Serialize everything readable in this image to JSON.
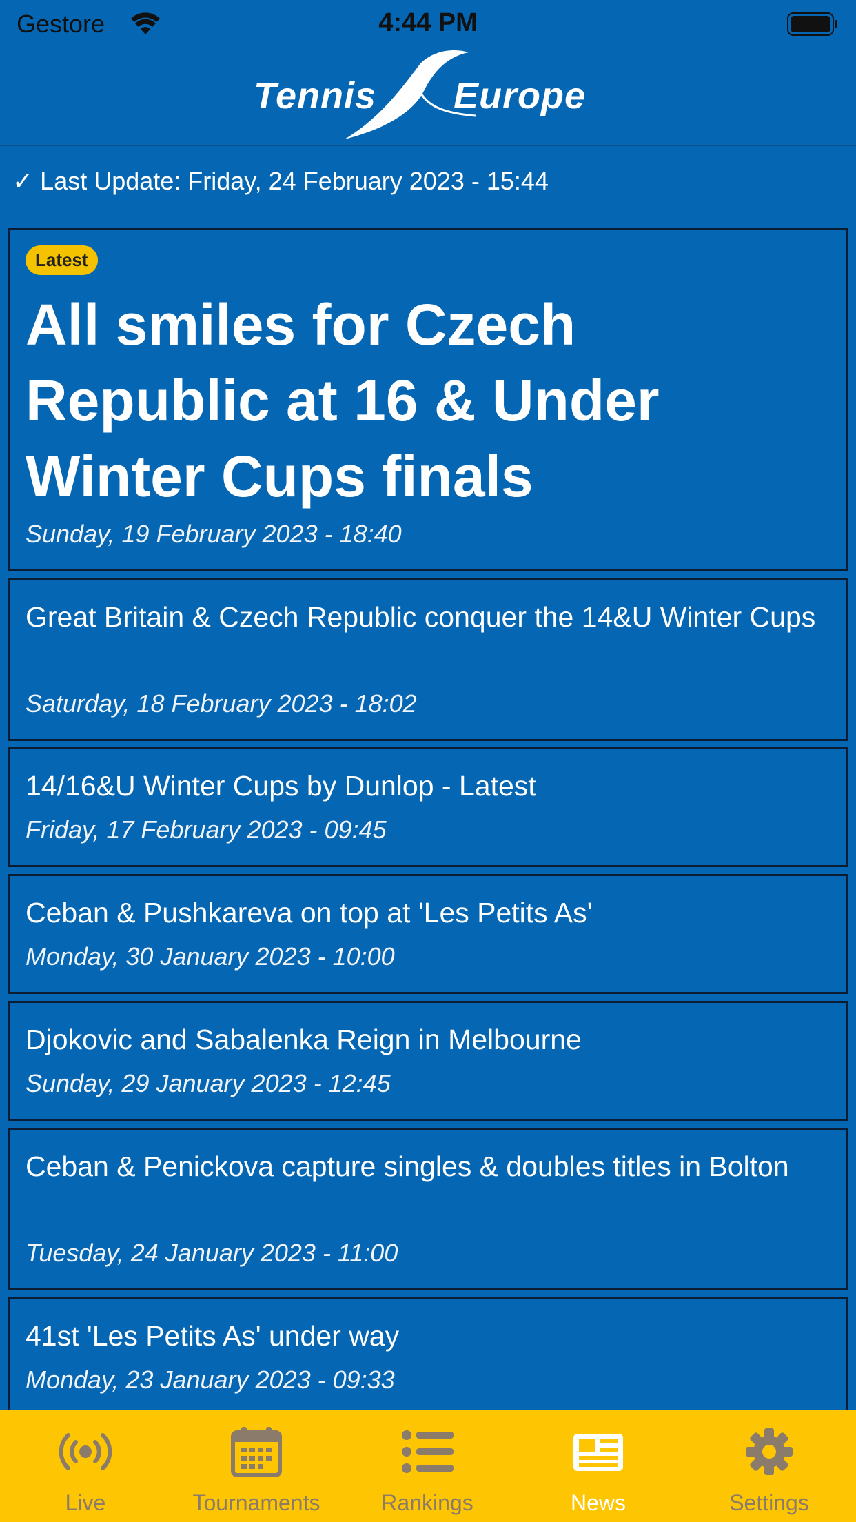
{
  "status_bar": {
    "carrier": "Gestore",
    "time": "4:44 PM"
  },
  "header": {
    "logo_left": "Tennis",
    "logo_right": "Europe"
  },
  "last_update": "✓ Last Update: Friday, 24 February 2023 - 15:44",
  "news": [
    {
      "badge": "Latest",
      "title": "All smiles for Czech Republic at 16 & Under Winter Cups finals",
      "date": "Sunday, 19 February 2023 - 18:40"
    },
    {
      "title": "Great Britain & Czech Republic conquer the 14&U Winter Cups",
      "date": "Saturday, 18 February 2023 - 18:02"
    },
    {
      "title": "14/16&U Winter Cups by Dunlop - Latest",
      "date": "Friday, 17 February 2023 - 09:45"
    },
    {
      "title": "Ceban & Pushkareva on top at 'Les Petits As'",
      "date": "Monday, 30 January 2023 - 10:00"
    },
    {
      "title": "Djokovic and Sabalenka Reign in Melbourne",
      "date": "Sunday, 29 January 2023 - 12:45"
    },
    {
      "title": "Ceban & Penickova capture singles & doubles titles in Bolton",
      "date": "Tuesday, 24 January 2023 - 11:00"
    },
    {
      "title": "41st 'Les Petits As' under way",
      "date": "Monday, 23 January 2023 - 09:33"
    }
  ],
  "tabs": [
    {
      "label": "Live",
      "icon": "live-broadcast-icon"
    },
    {
      "label": "Tournaments",
      "icon": "calendar-icon"
    },
    {
      "label": "Rankings",
      "icon": "list-icon"
    },
    {
      "label": "News",
      "icon": "newspaper-icon",
      "active": true
    },
    {
      "label": "Settings",
      "icon": "gear-icon"
    }
  ],
  "colors": {
    "background": "#0566b3",
    "tab_bar": "#fec502",
    "badge": "#f5c200",
    "inactive_tab": "#8a7b6a"
  }
}
